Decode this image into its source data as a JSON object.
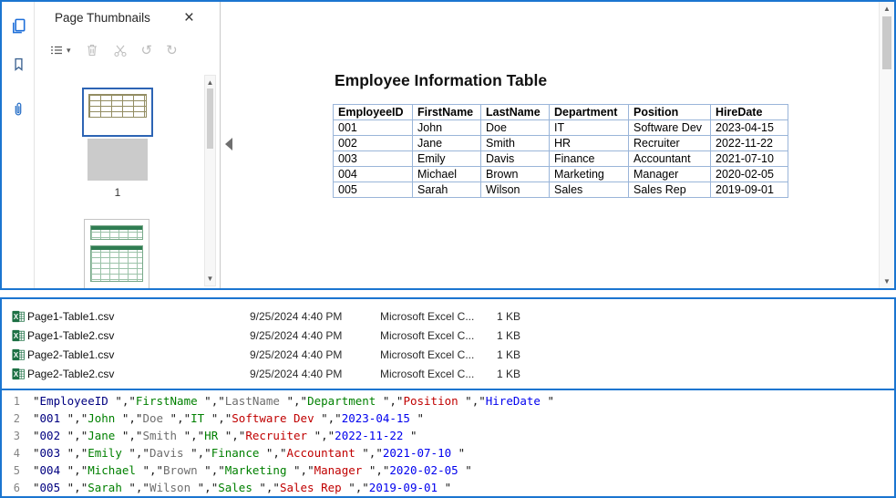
{
  "icons": {
    "close": "×",
    "caret_down": "▾",
    "scroll_up": "▲",
    "scroll_down": "▼",
    "rotate_left": "↺",
    "rotate_right": "↻"
  },
  "colors": {
    "section_border": "#1b75d0",
    "thumbnail_selection": "#2d64b4",
    "pdf_table_border": "#9ab5d9",
    "excel_icon_green": "#1d7044"
  },
  "pdf_viewer": {
    "left_toolbar_icons": [
      "page-thumbnails",
      "bookmarks",
      "attachments"
    ],
    "thumbnail_panel": {
      "title": "Page Thumbnails",
      "page1_label": "1"
    },
    "document": {
      "title": "Employee Information Table",
      "table": {
        "headers": [
          "EmployeeID",
          "FirstName",
          "LastName",
          "Department",
          "Position",
          "HireDate"
        ],
        "rows": [
          [
            "001",
            "John",
            "Doe",
            "IT",
            "Software Dev",
            "2023-04-15"
          ],
          [
            "002",
            "Jane",
            "Smith",
            "HR",
            "Recruiter",
            "2022-11-22"
          ],
          [
            "003",
            "Emily",
            "Davis",
            "Finance",
            "Accountant",
            "2021-07-10"
          ],
          [
            "004",
            "Michael",
            "Brown",
            "Marketing",
            "Manager",
            "2020-02-05"
          ],
          [
            "005",
            "Sarah",
            "Wilson",
            "Sales",
            "Sales Rep",
            "2019-09-01"
          ]
        ]
      }
    }
  },
  "file_list": {
    "files": [
      {
        "name": "Page1-Table1.csv",
        "date_modified": "9/25/2024 4:40 PM",
        "type": "Microsoft Excel C...",
        "size": "1 KB"
      },
      {
        "name": "Page1-Table2.csv",
        "date_modified": "9/25/2024 4:40 PM",
        "type": "Microsoft Excel C...",
        "size": "1 KB"
      },
      {
        "name": "Page2-Table1.csv",
        "date_modified": "9/25/2024 4:40 PM",
        "type": "Microsoft Excel C...",
        "size": "1 KB"
      },
      {
        "name": "Page2-Table2.csv",
        "date_modified": "9/25/2024 4:40 PM",
        "type": "Microsoft Excel C...",
        "size": "1 KB"
      }
    ]
  },
  "editor": {
    "line_numbers": [
      "1",
      "2",
      "3",
      "4",
      "5",
      "6"
    ],
    "column_colors": [
      "#000080",
      "#008000",
      "#6e6e6e",
      "#008000",
      "#c00000",
      "#0000ee"
    ],
    "punctuation_color": "#1a1a1a",
    "lines": [
      [
        "EmployeeID ",
        "FirstName ",
        "LastName ",
        "Department ",
        "Position ",
        "HireDate "
      ],
      [
        "001 ",
        "John ",
        "Doe ",
        "IT ",
        "Software Dev ",
        "2023-04-15 "
      ],
      [
        "002 ",
        "Jane ",
        "Smith ",
        "HR ",
        "Recruiter ",
        "2022-11-22 "
      ],
      [
        "003 ",
        "Emily ",
        "Davis ",
        "Finance ",
        "Accountant ",
        "2021-07-10 "
      ],
      [
        "004 ",
        "Michael ",
        "Brown ",
        "Marketing ",
        "Manager ",
        "2020-02-05 "
      ],
      [
        "005 ",
        "Sarah ",
        "Wilson ",
        "Sales ",
        "Sales Rep ",
        "2019-09-01 "
      ]
    ]
  }
}
